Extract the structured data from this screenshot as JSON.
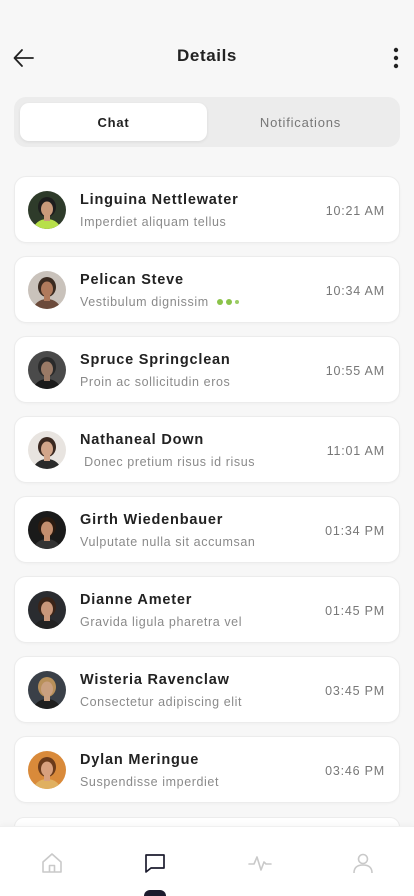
{
  "header": {
    "title": "Details"
  },
  "tabs": [
    {
      "label": "Chat",
      "active": true
    },
    {
      "label": "Notifications",
      "active": false
    }
  ],
  "chats": [
    {
      "name": "Linguina Nettlewater",
      "preview": "Imperdiet aliquam tellus",
      "time": "10:21 AM",
      "typing": false,
      "avatar": {
        "bg": "#2e3b2a",
        "skin": "#c99a7a",
        "hair": "#1d1d1d",
        "accent": "#b7e04a"
      }
    },
    {
      "name": "Pelican Steve",
      "preview": "Vestibulum dignissim",
      "time": "10:34 AM",
      "typing": true,
      "avatar": {
        "bg": "#c9c2bb",
        "skin": "#b07a5c",
        "hair": "#3a2a20",
        "accent": "#6b4a3a"
      }
    },
    {
      "name": "Spruce Springclean",
      "preview": "Proin ac sollicitudin eros",
      "time": "10:55 AM",
      "typing": false,
      "avatar": {
        "bg": "#4a4a4a",
        "skin": "#9a7a66",
        "hair": "#2a2a2a",
        "accent": "#1a1a1a"
      }
    },
    {
      "name": "Nathaneal Down",
      "preview": " Donec pretium risus id risus",
      "time": "11:01 AM",
      "typing": false,
      "avatar": {
        "bg": "#e8e4e0",
        "skin": "#d2a58a",
        "hair": "#3a2820",
        "accent": "#2a2a2a"
      }
    },
    {
      "name": "Girth Wiedenbauer",
      "preview": "Vulputate nulla sit accumsan",
      "time": "01:34 PM",
      "typing": false,
      "avatar": {
        "bg": "#1a1a1a",
        "skin": "#c48e6e",
        "hair": "#2a1a10",
        "accent": "#333333"
      }
    },
    {
      "name": "Dianne Ameter",
      "preview": "Gravida ligula pharetra vel",
      "time": "01:45 PM",
      "typing": false,
      "avatar": {
        "bg": "#2a2c30",
        "skin": "#c9977a",
        "hair": "#3a2418",
        "accent": "#222222"
      }
    },
    {
      "name": "Wisteria Ravenclaw",
      "preview": "Consectetur adipiscing elit",
      "time": "03:45 PM",
      "typing": false,
      "avatar": {
        "bg": "#3a4048",
        "skin": "#caa080",
        "hair": "#b8905a",
        "accent": "#1e1e1e"
      }
    },
    {
      "name": "Dylan Meringue",
      "preview": "Suspendisse imperdiet",
      "time": "03:46 PM",
      "typing": false,
      "avatar": {
        "bg": "#d98a3a",
        "skin": "#d8a07e",
        "hair": "#6a3a1a",
        "accent": "#e0b060"
      }
    }
  ],
  "nav": [
    {
      "icon": "home-icon",
      "active": false
    },
    {
      "icon": "chat-icon",
      "active": true
    },
    {
      "icon": "activity-icon",
      "active": false
    },
    {
      "icon": "profile-icon",
      "active": false
    }
  ],
  "colors": {
    "background": "#f7f7f7",
    "typing_dot": "#8bc34a",
    "nav_active": "#1c1c2e",
    "nav_inactive": "#c9c9c9"
  }
}
